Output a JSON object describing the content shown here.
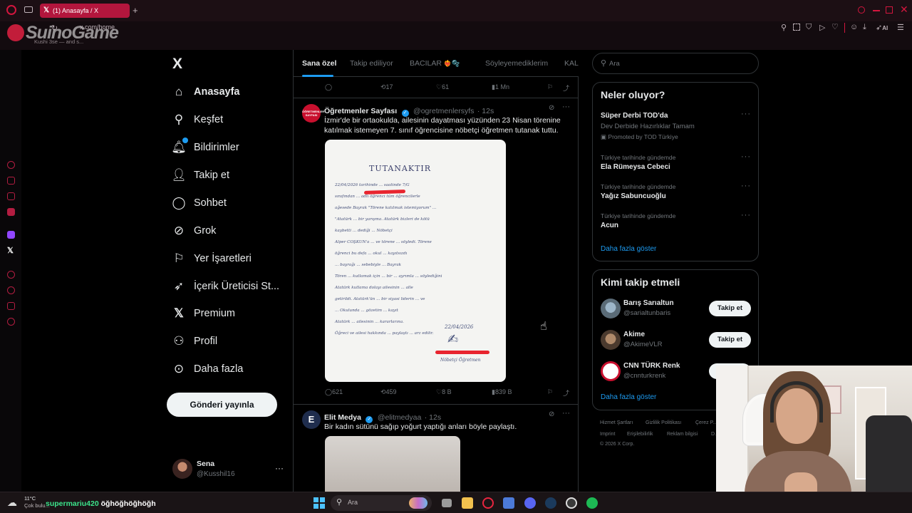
{
  "browser": {
    "tab_title": "(1) Anasayfa / X",
    "new_tab": "+",
    "url": "x.com/home",
    "logo_overlay": "SuinoGame",
    "bookmark_snippet": "Kushi 3se — and s...",
    "ai_label": "AI"
  },
  "nav": {
    "logo": "X",
    "items": [
      {
        "label": "Anasayfa",
        "icon": "home-icon"
      },
      {
        "label": "Keşfet",
        "icon": "search-icon"
      },
      {
        "label": "Bildirimler",
        "icon": "bell-icon"
      },
      {
        "label": "Takip et",
        "icon": "person-add-icon"
      },
      {
        "label": "Sohbet",
        "icon": "chat-icon"
      },
      {
        "label": "Grok",
        "icon": "grok-icon"
      },
      {
        "label": "Yer İşaretleri",
        "icon": "bookmark-icon"
      },
      {
        "label": "İçerik Üreticisi St...",
        "icon": "rocket-icon"
      },
      {
        "label": "Premium",
        "icon": "x-icon"
      },
      {
        "label": "Profil",
        "icon": "profile-icon"
      },
      {
        "label": "Daha fazla",
        "icon": "more-circle-icon"
      }
    ],
    "post_button": "Gönderi yayınla",
    "account": {
      "name": "Sena",
      "handle": "@Kusshil16",
      "more": "···"
    }
  },
  "feed": {
    "tabs": [
      "Sana özel",
      "Takip ediliyor",
      "BACILAR",
      "Söyleyemediklerim",
      "KAL"
    ],
    "tab_emoji": "❤️‍🔥🫧",
    "prev_actions": {
      "retweets": "17",
      "likes": "61",
      "views": "1 Mn"
    },
    "tweets": [
      {
        "name": "Öğretmenler Sayfası",
        "handle": "@ogretmenlersyfs",
        "time": "· 12s",
        "avatar_text": "ÖĞRETMENLER SAYFASI",
        "text": "İzmir'de bir ortaokulda, ailesinin dayatması yüzünden 23 Nisan törenine katılmak istemeyen 7. sınıf öğrencisine nöbetçi öğretmen tutanak tuttu.",
        "document": {
          "heading": "TUTANAKTIR",
          "date": "22/04/2026",
          "body": [
            "22/04/2026 tarihinde ... saatinde 7/G",
            "sınıfından ... adlı öğrenci tüm öğrencilerle",
            "ağesede Bayrak \"Törene katılmak istemiyorum\" ...",
            "\"Atatürk ... bir yarışma. Atatürk bizleri de kötü",
            "kaybetti ... dediği ... Nöbetçi",
            "Alper COŞKUN'a ... ve törene ... söyledi. Törene",
            "öğrenci bu defa ... okul ... kayıtsızdı",
            "... bayrağı ... sebebiyle ... Bayrak",
            "Tören ... kutlamak için ... bir ... ayrımla ... söylediğini",
            "Atatürk kutlama dolayı ailesinin ... alle",
            "getirildi. Atatürk'ün ... bir siyasi liderin ... ve",
            "... Okulunda ... gözetim ... kayıt",
            "Atatürk ... ailesinin ... kararlarına.",
            "Öğreci ve ailesi hakkında ... paylaştı ... arz edilir."
          ],
          "signature": "Nöbetçi Öğretmen"
        },
        "actions": {
          "replies": "621",
          "retweets": "459",
          "likes": "8 B",
          "views": "839 B"
        }
      },
      {
        "name": "Elit Medya",
        "handle": "@elitmedyaa",
        "time": "· 12s",
        "avatar_text": "E",
        "text": "Bir kadın sütünü sağıp yoğurt yaptığı anları böyle paylaştı."
      }
    ]
  },
  "right": {
    "search_placeholder": "Ara",
    "trends_title": "Neler oluyor?",
    "trends": [
      {
        "category": "",
        "title": "Süper Derbi TOD'da",
        "subtitle": "Dev Derbide Hazırlıklar Tamam",
        "promoted": "Promoted by TOD Türkiye"
      },
      {
        "category": "Türkiye tarihinde gündemde",
        "title": "Ela Rümeysa Cebeci"
      },
      {
        "category": "Türkiye tarihinde gündemde",
        "title": "Yağız Sabuncuoğlu"
      },
      {
        "category": "Türkiye tarihinde gündemde",
        "title": "Acun"
      }
    ],
    "show_more": "Daha fazla göster",
    "who_title": "Kimi takip etmeli",
    "who": [
      {
        "name": "Barış Sarıaltun",
        "handle": "@sarialtunbaris",
        "button": "Takip et"
      },
      {
        "name": "Akime",
        "handle": "@AkimeVLR",
        "button": "Takip et"
      },
      {
        "name": "CNN TÜRK Renk",
        "handle": "@cnnturkrenk",
        "button": "Takip et"
      }
    ],
    "who_more": "Daha fazla göster",
    "footer": [
      "Hizmet Şartları",
      "Gizlilik Politikası",
      "Çerez P...",
      "Imprint",
      "Erişilebilirlik",
      "Reklam bilgisi",
      "D...",
      "© 2026 X Corp."
    ]
  },
  "taskbar": {
    "temp": "11°C",
    "weather": "Çok bulu...",
    "chat_user": "supermariu420",
    "chat_msg": "öğhöğhöğhöğh",
    "search": "Ara"
  },
  "colors": {
    "accent": "#1d9bf0",
    "browser_red": "#b3163d",
    "bg": "#000000",
    "border": "#2f3336"
  }
}
